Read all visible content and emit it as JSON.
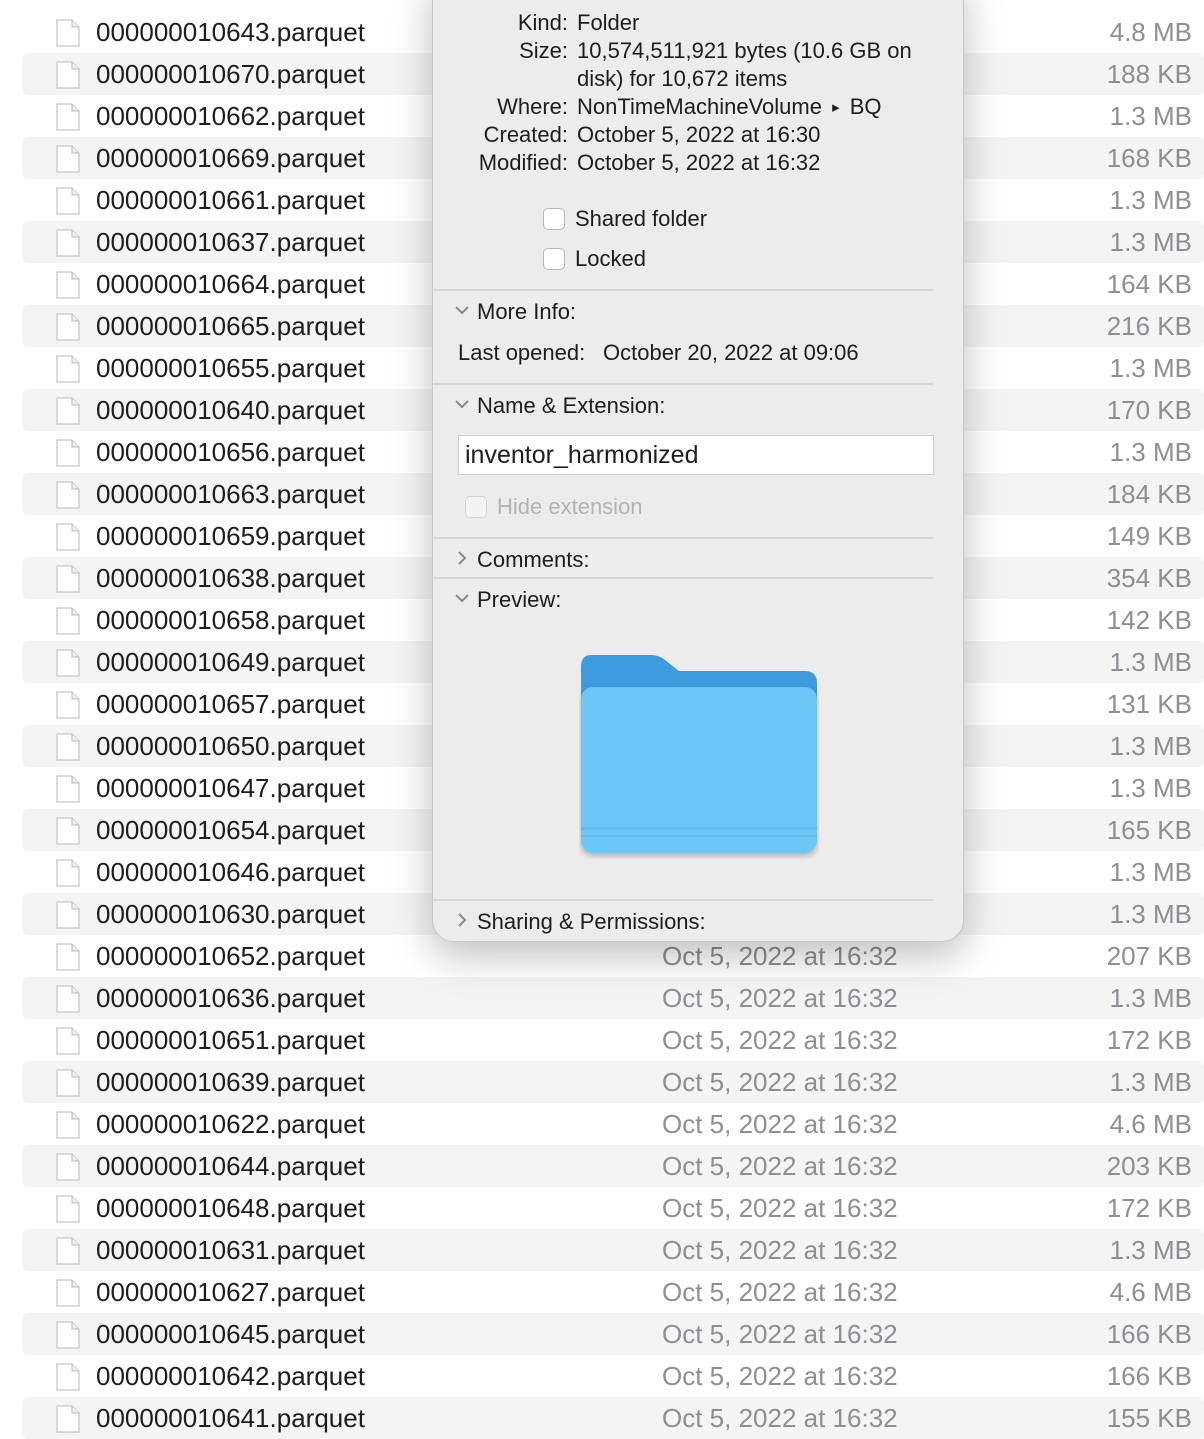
{
  "files": [
    {
      "name": "000000010643.parquet",
      "date": "",
      "size": "4.8 MB"
    },
    {
      "name": "000000010670.parquet",
      "date": "",
      "size": "188 KB"
    },
    {
      "name": "000000010662.parquet",
      "date": "",
      "size": "1.3 MB"
    },
    {
      "name": "000000010669.parquet",
      "date": "",
      "size": "168 KB"
    },
    {
      "name": "000000010661.parquet",
      "date": "",
      "size": "1.3 MB"
    },
    {
      "name": "000000010637.parquet",
      "date": "",
      "size": "1.3 MB"
    },
    {
      "name": "000000010664.parquet",
      "date": "",
      "size": "164 KB"
    },
    {
      "name": "000000010665.parquet",
      "date": "",
      "size": "216 KB"
    },
    {
      "name": "000000010655.parquet",
      "date": "",
      "size": "1.3 MB"
    },
    {
      "name": "000000010640.parquet",
      "date": "",
      "size": "170 KB"
    },
    {
      "name": "000000010656.parquet",
      "date": "",
      "size": "1.3 MB"
    },
    {
      "name": "000000010663.parquet",
      "date": "",
      "size": "184 KB"
    },
    {
      "name": "000000010659.parquet",
      "date": "",
      "size": "149 KB"
    },
    {
      "name": "000000010638.parquet",
      "date": "",
      "size": "354 KB"
    },
    {
      "name": "000000010658.parquet",
      "date": "",
      "size": "142 KB"
    },
    {
      "name": "000000010649.parquet",
      "date": "",
      "size": "1.3 MB"
    },
    {
      "name": "000000010657.parquet",
      "date": "",
      "size": "131 KB"
    },
    {
      "name": "000000010650.parquet",
      "date": "",
      "size": "1.3 MB"
    },
    {
      "name": "000000010647.parquet",
      "date": "",
      "size": "1.3 MB"
    },
    {
      "name": "000000010654.parquet",
      "date": "",
      "size": "165 KB"
    },
    {
      "name": "000000010646.parquet",
      "date": "",
      "size": "1.3 MB"
    },
    {
      "name": "000000010630.parquet",
      "date": "",
      "size": "1.3 MB"
    },
    {
      "name": "000000010652.parquet",
      "date": "Oct 5, 2022 at 16:32",
      "size": "207 KB"
    },
    {
      "name": "000000010636.parquet",
      "date": "Oct 5, 2022 at 16:32",
      "size": "1.3 MB"
    },
    {
      "name": "000000010651.parquet",
      "date": "Oct 5, 2022 at 16:32",
      "size": "172 KB"
    },
    {
      "name": "000000010639.parquet",
      "date": "Oct 5, 2022 at 16:32",
      "size": "1.3 MB"
    },
    {
      "name": "000000010622.parquet",
      "date": "Oct 5, 2022 at 16:32",
      "size": "4.6 MB"
    },
    {
      "name": "000000010644.parquet",
      "date": "Oct 5, 2022 at 16:32",
      "size": "203 KB"
    },
    {
      "name": "000000010648.parquet",
      "date": "Oct 5, 2022 at 16:32",
      "size": "172 KB"
    },
    {
      "name": "000000010631.parquet",
      "date": "Oct 5, 2022 at 16:32",
      "size": "1.3 MB"
    },
    {
      "name": "000000010627.parquet",
      "date": "Oct 5, 2022 at 16:32",
      "size": "4.6 MB"
    },
    {
      "name": "000000010645.parquet",
      "date": "Oct 5, 2022 at 16:32",
      "size": "166 KB"
    },
    {
      "name": "000000010642.parquet",
      "date": "Oct 5, 2022 at 16:32",
      "size": "166 KB"
    },
    {
      "name": "000000010641.parquet",
      "date": "Oct 5, 2022 at 16:32",
      "size": "155 KB"
    }
  ],
  "info": {
    "kind_label": "Kind:",
    "kind": "Folder",
    "size_label": "Size:",
    "size_line1": "10,574,511,921 bytes (10.6 GB on",
    "size_line2": "disk) for 10,672 items",
    "where_label": "Where:",
    "where_path": "NonTimeMachineVolume",
    "where_sep": "▸",
    "where_folder": "BQ",
    "created_label": "Created:",
    "created": "October 5, 2022 at 16:30",
    "modified_label": "Modified:",
    "modified": "October 5, 2022 at 16:32",
    "shared_folder_label": "Shared folder",
    "locked_label": "Locked",
    "more_info_title": "More Info:",
    "last_opened_label": "Last opened:",
    "last_opened": "October 20, 2022 at 09:06",
    "name_ext_title": "Name & Extension:",
    "name_value": "inventor_harmonized",
    "hide_extension_label": "Hide extension",
    "comments_title": "Comments:",
    "preview_title": "Preview:",
    "sharing_title": "Sharing & Permissions:"
  },
  "colors": {
    "folder_back": "#3e9be0",
    "folder_front": "#6cc6f6",
    "row_alt": "#f4f4f5",
    "panel_bg": "#ececec"
  },
  "icons": {
    "file": "document-icon",
    "folder": "folder-icon",
    "disclosure_open": "chevron-down-icon",
    "disclosure_closed": "chevron-right-icon"
  }
}
